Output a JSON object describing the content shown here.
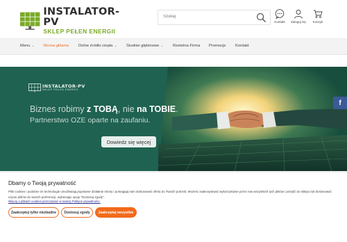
{
  "header": {
    "logo_main": "INSTALATOR-PV",
    "logo_sub": "SKLEP PEŁEN ENERGII",
    "search_placeholder": "Szukaj",
    "actions": [
      {
        "label": "Kontakt",
        "icon": "chat-icon"
      },
      {
        "label": "Zaloguj się",
        "icon": "user-icon"
      },
      {
        "label": "Koszyk",
        "icon": "cart-icon"
      }
    ]
  },
  "nav": {
    "items": [
      {
        "label": "Menu",
        "has_dropdown": true
      },
      {
        "label": "Strona główna",
        "has_dropdown": false,
        "active": true
      },
      {
        "label": "Dolne źródło ciepła",
        "has_dropdown": true
      },
      {
        "label": "Studnie głębinowe",
        "has_dropdown": true
      },
      {
        "label": "Rzetelna Firma",
        "has_dropdown": false
      },
      {
        "label": "Promocje",
        "has_dropdown": false
      },
      {
        "label": "Kontakt",
        "has_dropdown": false
      }
    ],
    "active_color": "#e8702a"
  },
  "hero": {
    "logo_main": "INSTALATOR-PV",
    "logo_sub": "SKLEP PEŁEN ENERGII",
    "headline_a": "Biznes robimy ",
    "headline_b": "z TOBĄ",
    "headline_c": ", nie ",
    "headline_d": "na TOBIE",
    "headline_e": ".",
    "subline": "Partnerstwo OZE oparte na zaufaniu.",
    "button_label": "Dowiedz się więcej",
    "background": "#1f6251"
  },
  "social": {
    "facebook_label": "f"
  },
  "cookie": {
    "title": "Dbamy o Twoją prywatność",
    "text": "Pliki cookies i podobne im technologie umożliwiają poprawne działanie strony i pomagają nam dostosować ofertę do Twoich potrzeb. Możesz zaakceptować wykorzystanie przez nas wszystkich tych plików i przejść do sklepu lub dostosować użycie plików do swoich preferencji, wybierając opcję \"Dostosuj zgody\".",
    "link": "Więcej o plikach cookies przeczytasz w naszej Polityce prywatności.",
    "btn_necessary": "Zaakceptuj tylko niezbędne",
    "btn_customize": "Dostosuj zgody",
    "btn_accept_all": "Zaakceptuj wszystkie",
    "accent": "#f26a1b"
  }
}
